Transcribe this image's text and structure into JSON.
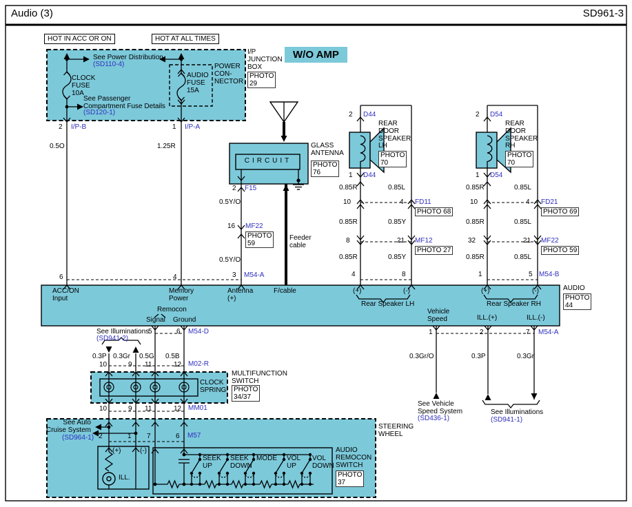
{
  "header": {
    "title": "Audio (3)",
    "code": "SD961-3"
  },
  "badge": "W/O AMP",
  "colors": {
    "cyan": "#7cc9da",
    "blue": "#2f2fbe"
  },
  "power": {
    "hot_acc": "HOT IN ACC OR ON",
    "hot_all": "HOT AT ALL TIMES",
    "see_power": "See Power Distribution",
    "see_power_ref": "(SD110-4)",
    "clock_fuse": "CLOCK\nFUSE\n10A",
    "see_passenger": "See Passenger\nCompartment Fuse Details",
    "see_passenger_ref": "(SD120-1)",
    "audio_fuse": "AUDIO\nFUSE\n15A",
    "connector_label": "POWER\nCON-\nNECTOR",
    "junction_label": "I/P\nJUNCTION\nBOX",
    "junction_photo": "PHOTO\n29",
    "pin_left": "2",
    "conn_left": "I/P-B",
    "pin_right": "1",
    "conn_right": "I/P-A",
    "wire_left": "0.5O",
    "wire_right": "1.25R",
    "bus_pin_left": "6",
    "bus_pin_right": "4"
  },
  "antenna": {
    "circuit": "CIRCUIT",
    "glass_label": "GLASS\nANTENNA",
    "glass_photo": "PHOTO\n76",
    "pin_top": "2",
    "conn_top": "F15",
    "wire_upper": "0.5Y/O",
    "pin_mid": "16",
    "conn_mid": "MF22",
    "mid_photo": "PHOTO\n59",
    "wire_lower": "0.5Y/O",
    "pin_bus": "3",
    "conn_bus": "M54-A",
    "feeder_label": "Feeder\ncable"
  },
  "speaker_lh": {
    "pin_top": "2",
    "conn_top": "D44",
    "name": "REAR\nDOOR\nSPEAKER\nLH",
    "photo": "PHOTO\n70",
    "pin_bottom": "1",
    "conn_bottom": "D44",
    "seg1_left": "0.85R",
    "seg1_right": "0.85L",
    "c1_pin_left": "10",
    "c1_pin_right": "4",
    "c1_name": "FD11",
    "c1_photo": "PHOTO 68",
    "seg2_left": "0.85R",
    "seg2_right": "0.85Y",
    "c2_pin_left": "8",
    "c2_pin_right": "21",
    "c2_name": "MF12",
    "c2_photo": "PHOTO 27",
    "seg3_left": "0.85R",
    "seg3_right": "0.85Y",
    "bus_pin_left": "4",
    "bus_pin_right": "8"
  },
  "speaker_rh": {
    "pin_top": "2",
    "conn_top": "D54",
    "name": "REAR\nDOOR\nSPEAKER\nRH",
    "photo": "PHOTO\n70",
    "pin_bottom": "1",
    "conn_bottom": "D54",
    "seg1_left": "0.85R",
    "seg1_right": "0.85L",
    "c1_pin_left": "10",
    "c1_pin_right": "4",
    "c1_name": "FD21",
    "c1_photo": "PHOTO 69",
    "seg2_left": "0.85R",
    "seg2_right": "0.85L",
    "c2_pin_left": "32",
    "c2_pin_right": "21",
    "c2_name": "MF22",
    "c2_photo": "PHOTO 59",
    "seg3_left": "0.85R",
    "seg3_right": "0.85L",
    "bus_pin_left": "1",
    "bus_pin_right": "5",
    "conn_bus": "M54-B"
  },
  "audio_unit": {
    "acc_label": "ACC/ON\nInput",
    "memory_label": "Memory\nPower",
    "antenna_label": "Antenna\n(+)",
    "fcable_label": "F/cable",
    "lh_plus": "(+)",
    "lh_minus": "(-)",
    "lh_label": "Rear Speaker LH",
    "rh_plus": "(+)",
    "rh_minus": "(-)",
    "rh_label": "Rear Speaker RH",
    "remocon": "Remocon",
    "signal": "Signal",
    "ground": "Ground",
    "vehicle_label": "Vehicle\nSpeed",
    "ill_plus": "ILL.(+)",
    "ill_minus": "ILL.(-)",
    "name": "AUDIO",
    "photo": "PHOTO\n44"
  },
  "remocon_column": {
    "see_illum": "See Illuminations",
    "see_illum_ref": "(SD941-2)",
    "pin_signal": "5",
    "pin_ground": "6",
    "conn_top": "M54-D",
    "w1": "0.3P",
    "p1": "10",
    "w2": "0.3Gr",
    "p2": "9",
    "w3": "0.5G",
    "p3": "11",
    "w4": "0.5B",
    "p4": "12",
    "conn_mid": "M02-R",
    "clock_spring": "CLOCK\nSPRING",
    "multifunction": "MULTIFUNCTION\nSWITCH",
    "multifunction_photo": "PHOTO\n34/37",
    "bp1": "10",
    "bp2": "9",
    "bp3": "11",
    "bp4": "12",
    "conn_bottom": "MM01"
  },
  "steering": {
    "label": "STEERING\nWHEEL",
    "see_cruise": "See Auto\nCruise System",
    "see_cruise_ref": "(SD964-1)",
    "pin1": "2",
    "pin2": "1",
    "pin3": "7",
    "pin4": "6",
    "conn": "M57",
    "plus": "(+)",
    "minus": "(-)",
    "ill": "ILL.",
    "switches": [
      "SEEK\nUP",
      "SEEK\nDOWN",
      "MODE",
      "VOL\nUP",
      "VOL\nDOWN"
    ],
    "remocon_switch": "AUDIO\nREMOCON\nSWITCH",
    "remocon_photo": "PHOTO\n37"
  },
  "lower_right": {
    "pin1": "1",
    "pin2": "2",
    "pin3": "7",
    "conn": "M54-A",
    "w1": "0.3Gr/O",
    "w2": "0.3P",
    "w3": "0.3Gr",
    "see_vehicle": "See Vehicle\nSpeed System",
    "see_vehicle_ref": "(SD436-1)",
    "see_illum": "See Illuminations",
    "see_illum_ref": "(SD941-1)"
  }
}
